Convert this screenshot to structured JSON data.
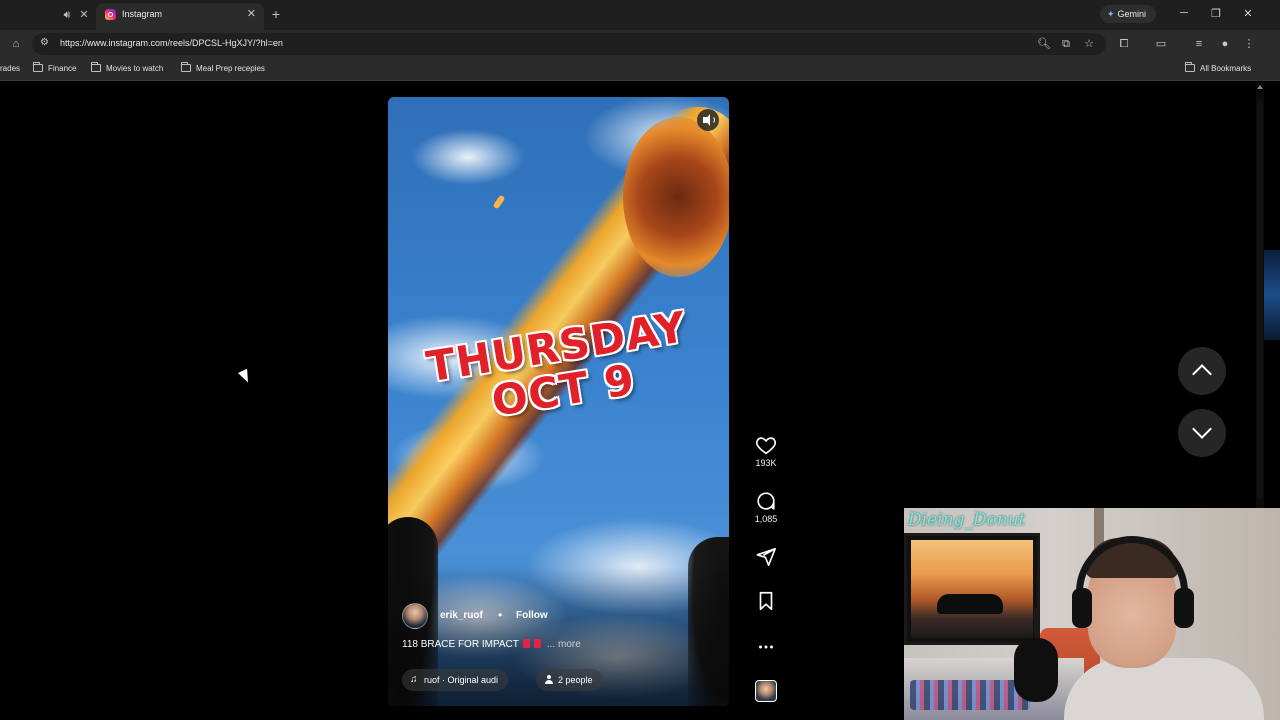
{
  "browser": {
    "prev_tab_hint": "",
    "tab_title": "Instagram",
    "url": "https://www.instagram.com/reels/DPCSL-HgXJY/?hl=en",
    "gemini_label": "Gemini",
    "bookmarks": [
      {
        "label": "rades"
      },
      {
        "label": "Finance"
      },
      {
        "label": "Movies to watch"
      },
      {
        "label": "Meal Prep recepies"
      }
    ],
    "all_bookmarks": "All Bookmarks"
  },
  "reel": {
    "headline_line1": "THURSDAY",
    "headline_line2": "OCT 9",
    "author": "erik_ruof",
    "follow_label": "Follow",
    "separator": "•",
    "caption": "118 BRACE FOR IMPACT",
    "more_label": "... more",
    "audio_label": "ruof · Original audi",
    "people_label": "2 people"
  },
  "actions": {
    "likes": "193K",
    "comments": "1,085"
  },
  "webcam": {
    "handle": "Dieing_Donut"
  },
  "colors": {
    "accent_red": "#e1202a",
    "page_bg": "#000000",
    "chrome_bg": "#2b2b2b",
    "handle_color": "#7fe6d8"
  }
}
